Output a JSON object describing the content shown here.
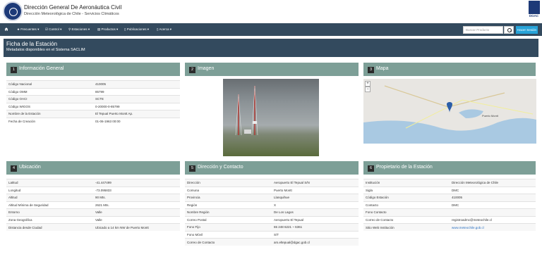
{
  "header": {
    "title": "Dirección General De Aeronáutica Civil",
    "subtitle": "Dirección Meteorológica de Chile - Servicios Climáticos",
    "logo_right_label": "DGAC"
  },
  "nav": {
    "items": [
      "Frecuentes",
      "Control",
      "Estaciones",
      "Productos",
      "Publicaciones",
      "Acerca"
    ],
    "search_placeholder": "Buscar Producto",
    "ver_button": "Hacer Sesión"
  },
  "page": {
    "title": "Ficha de la Estación",
    "subtitle": "Metadatos disponibles en el Sistema SACLIM"
  },
  "panels": {
    "info": {
      "num": "1",
      "title": "Información General",
      "rows": [
        [
          "Código Nacional",
          "410005"
        ],
        [
          "Código OMM",
          "85799"
        ],
        [
          "Código OACI",
          "SCTE"
        ],
        [
          "Código WIGOS",
          "0-20000-0-85799"
        ],
        [
          "Nombre de la Estación",
          "El Tepual Puerto Montt Ap."
        ],
        [
          "Fecha de Creación",
          "01-06-1963 00:00"
        ]
      ]
    },
    "imagen": {
      "num": "2",
      "title": "Imagen"
    },
    "mapa": {
      "num": "3",
      "title": "Mapa",
      "labels": {
        "city": "Puerto Montt",
        "zoom_in": "+",
        "zoom_out": "−"
      }
    },
    "ubicacion": {
      "num": "4",
      "title": "Ubicación",
      "rows": [
        [
          "Latitud",
          "-41.447499"
        ],
        [
          "Longitud",
          "-73.095833"
        ],
        [
          "Altitud",
          "90 Mts."
        ],
        [
          "Altitud Mínima de Seguridad",
          "2621 Mts."
        ],
        [
          "Entorno",
          "Valle"
        ],
        [
          "Zona Geográfica",
          "Valle"
        ],
        [
          "Distancia desde Ciudad",
          "Ubicado a 14 km NW de Puerto Montt"
        ]
      ]
    },
    "direccion": {
      "num": "5",
      "title": "Dirección y Contacto",
      "rows": [
        [
          "Dirección",
          "Aeropuerto El Tepual S/N"
        ],
        [
          "Comuna",
          "Puerto Montt"
        ],
        [
          "Provincia",
          "Llanquihue"
        ],
        [
          "Región",
          "X"
        ],
        [
          "Nombre Región",
          "De Los Lagos"
        ],
        [
          "Correo Postal",
          "Aeropuerto El Tepual"
        ],
        [
          "Fono Fijo",
          "65 248 6221 ~ 6361"
        ],
        [
          "Fono Móvil",
          "S/T"
        ],
        [
          "Correo de Contacto",
          "ars.eltepual@dgac.gob.cl"
        ]
      ]
    },
    "propietario": {
      "num": "6",
      "title": "Propietario de la Estación",
      "rows": [
        [
          "Institución",
          "Dirección Meteorológica de Chile"
        ],
        [
          "Sigla",
          "DMC"
        ],
        [
          "Código Estación",
          "410005"
        ],
        [
          "Contacto",
          "DMC"
        ],
        [
          "Fono Contacto",
          ""
        ],
        [
          "Correo de Contacto",
          "registroadmc@meteochile.cl"
        ],
        [
          "Sitio Web Institución",
          "www.meteochile.gob.cl"
        ]
      ]
    }
  },
  "colors": {
    "navbar": "#334a5e",
    "panel_header": "#7d9f97",
    "accent_button": "#27a3d8",
    "link": "#2a6fbf"
  }
}
